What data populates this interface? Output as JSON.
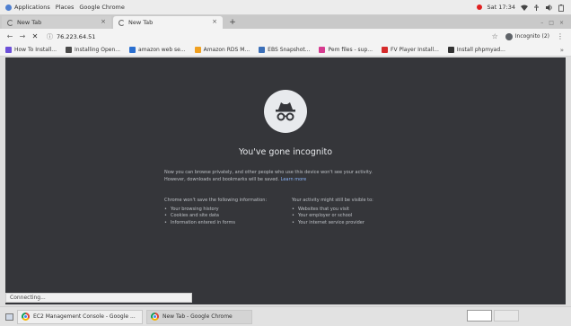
{
  "system_bar": {
    "applications": "Applications",
    "places": "Places",
    "app_name": "Google Chrome",
    "clock": "Sat 17:34"
  },
  "tabs": [
    {
      "title": "New Tab",
      "close": "×"
    },
    {
      "title": "New Tab",
      "close": "×"
    }
  ],
  "new_tab_symbol": "+",
  "window_controls": {
    "minimize": "–",
    "maximize": "□",
    "close": "×"
  },
  "toolbar": {
    "back": "←",
    "forward": "→",
    "stop": "✕",
    "info_icon": "ⓘ",
    "url": "76.223.64.51",
    "star": "☆",
    "incognito_label": "Incognito (2)",
    "menu": "⋮"
  },
  "bookmarks": [
    {
      "label": "How To Install...",
      "color": "#6c4fd8"
    },
    {
      "label": "Installing Open...",
      "color": "#4a4a4a"
    },
    {
      "label": "amazon web se...",
      "color": "#2a6fd0"
    },
    {
      "label": "Amazon RDS M...",
      "color": "#f0a020"
    },
    {
      "label": "EBS Snapshot...",
      "color": "#3b6fb8"
    },
    {
      "label": "Pem files - sup...",
      "color": "#d63b8f"
    },
    {
      "label": "FV Player Install...",
      "color": "#d62b2b"
    },
    {
      "label": "Install phpmyad...",
      "color": "#333333"
    }
  ],
  "bookmarks_more": "»",
  "incognito_page": {
    "heading": "You've gone incognito",
    "para_line1": "Now you can browse privately, and other people who use this device won't see your activity.",
    "para_line2": "However, downloads and bookmarks will be saved.",
    "learn_more": "Learn more",
    "left_title": "Chrome won't save the following information:",
    "left_items": [
      "Your browsing history",
      "Cookies and site data",
      "Information entered in forms"
    ],
    "right_title": "Your activity might still be visible to:",
    "right_items": [
      "Websites that you visit",
      "Your employer or school",
      "Your internet service provider"
    ]
  },
  "status_text": "Connecting...",
  "taskbar": {
    "items": [
      {
        "label": "EC2 Management Console - Google ..."
      },
      {
        "label": "New Tab - Google Chrome"
      }
    ]
  },
  "colors": {
    "incognito_bg": "#35363a",
    "link": "#8ab4f8",
    "record": "#e02020"
  }
}
